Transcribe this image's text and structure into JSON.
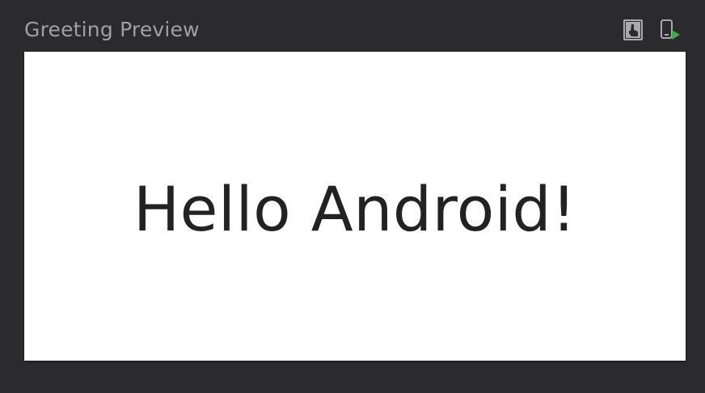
{
  "panel": {
    "title": "Greeting Preview"
  },
  "toolbar": {
    "buttons": [
      {
        "icon": "interactive-mode-icon",
        "color": "#a9a9ab"
      },
      {
        "icon": "deploy-to-device-icon",
        "color": "#a9a9ab",
        "accent": "#3fae4a"
      }
    ]
  },
  "preview": {
    "text": "Hello Android!",
    "background": "#ffffff",
    "text_color": "#222222"
  }
}
